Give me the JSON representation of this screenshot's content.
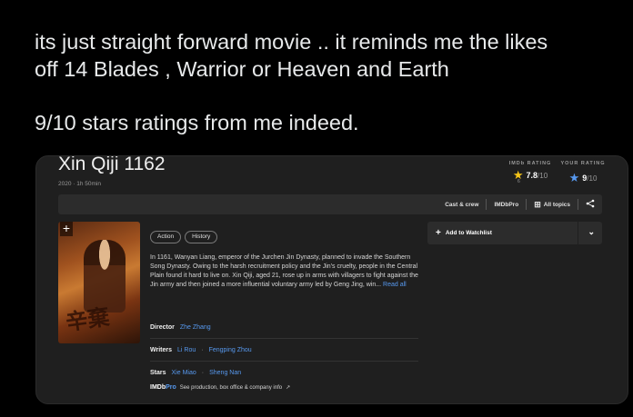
{
  "tweet": {
    "line1": "its just straight forward movie .. it reminds me the likes",
    "line2": "off 14 Blades ,  Warrior or Heaven and Earth",
    "line3": "9/10 stars ratings  from me indeed."
  },
  "movie": {
    "title": "Xin Qiji 1162",
    "meta": "2020 · 1h 50min",
    "imdb_rating_label": "IMDb RATING",
    "imdb_rating_value": "7.8",
    "imdb_rating_out": "/10",
    "imdb_votes": "6",
    "your_rating_label": "YOUR RATING",
    "your_rating_value": "9",
    "your_rating_out": "/10",
    "toolbar": {
      "cast_crew": "Cast & crew",
      "imdbpro": "IMDbPro",
      "all_topics": "All topics"
    },
    "genres": [
      "Action",
      "History"
    ],
    "plot": "In 1161, Wanyan Liang, emperor of the Jurchen Jin Dynasty, planned to invade the Southern Song Dynasty. Owing to the harsh recruitment policy and the Jin's cruelty, people in the Central Plain found it hard to live on. Xin Qiji, aged 21, rose up in arms with villagers to fight against the Jin army and then joined a more influential voluntary army led by Geng Jing, win...",
    "read_all": "Read all",
    "director_label": "Director",
    "director": "Zhe Zhang",
    "writers_label": "Writers",
    "writers": [
      "Li Rou",
      "Fengping Zhou"
    ],
    "stars_label": "Stars",
    "stars": [
      "Xie Miao",
      "Sheng Nan"
    ],
    "pro_logo_a": "IMDb",
    "pro_logo_b": "Pro",
    "pro_text": "See production, box office & company info",
    "watchlist": "Add to Watchlist"
  },
  "icons": {
    "star_gold": "★",
    "star_blue": "★",
    "grid": "⊞",
    "share": "<",
    "plus": "+",
    "chevron": "⌄",
    "external": "↗"
  },
  "colors": {
    "accent_gold": "#f5c518",
    "accent_blue": "#5799ef",
    "card_bg": "#1f1f1f"
  }
}
